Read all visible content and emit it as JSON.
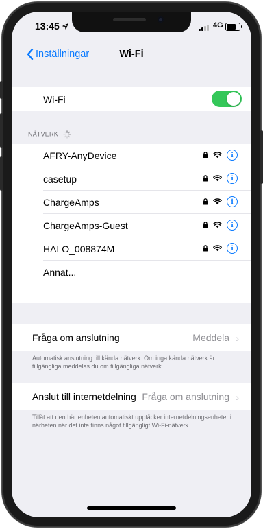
{
  "status": {
    "time": "13:45",
    "network": "4G"
  },
  "nav": {
    "back_label": "Inställningar",
    "title": "Wi-Fi"
  },
  "wifi_toggle": {
    "label": "Wi-Fi",
    "on": true
  },
  "networks_header": "NÄTVERK",
  "networks": [
    {
      "name": "AFRY-AnyDevice"
    },
    {
      "name": "casetup"
    },
    {
      "name": "ChargeAmps"
    },
    {
      "name": "ChargeAmps-Guest"
    },
    {
      "name": "HALO_008874M"
    }
  ],
  "other_label": "Annat...",
  "ask_to_join": {
    "label": "Fråga om anslutning",
    "value": "Meddela"
  },
  "ask_footnote": "Automatisk anslutning till kända nätverk. Om inga kända nätverk är tillgängliga meddelas du om tillgängliga nätverk.",
  "hotspot": {
    "label": "Anslut till internetdelning",
    "value": "Fråga om anslutning"
  },
  "hotspot_footnote": "Tillåt att den här enheten automatiskt upptäcker internetdelningsenheter i närheten när det inte finns något tillgängligt Wi-Fi-nätverk.",
  "colors": {
    "accent": "#0a7aff",
    "toggle_on": "#34c759",
    "background": "#efeff4"
  }
}
